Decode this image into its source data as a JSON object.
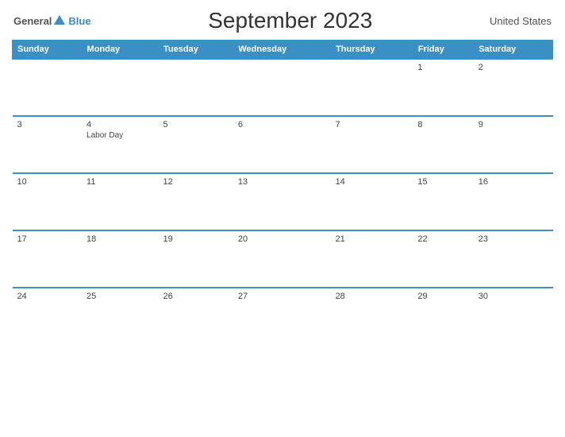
{
  "header": {
    "logo_general": "General",
    "logo_blue": "Blue",
    "title": "September 2023",
    "country": "United States"
  },
  "weekdays": [
    "Sunday",
    "Monday",
    "Tuesday",
    "Wednesday",
    "Thursday",
    "Friday",
    "Saturday"
  ],
  "weeks": [
    [
      {
        "day": "",
        "empty": true
      },
      {
        "day": "",
        "empty": true
      },
      {
        "day": "",
        "empty": true
      },
      {
        "day": "",
        "empty": true
      },
      {
        "day": "",
        "empty": true
      },
      {
        "day": "1",
        "empty": false
      },
      {
        "day": "2",
        "empty": false
      }
    ],
    [
      {
        "day": "3",
        "empty": false
      },
      {
        "day": "4",
        "empty": false,
        "holiday": "Labor Day"
      },
      {
        "day": "5",
        "empty": false
      },
      {
        "day": "6",
        "empty": false
      },
      {
        "day": "7",
        "empty": false
      },
      {
        "day": "8",
        "empty": false
      },
      {
        "day": "9",
        "empty": false
      }
    ],
    [
      {
        "day": "10",
        "empty": false
      },
      {
        "day": "11",
        "empty": false
      },
      {
        "day": "12",
        "empty": false
      },
      {
        "day": "13",
        "empty": false
      },
      {
        "day": "14",
        "empty": false
      },
      {
        "day": "15",
        "empty": false
      },
      {
        "day": "16",
        "empty": false
      }
    ],
    [
      {
        "day": "17",
        "empty": false
      },
      {
        "day": "18",
        "empty": false
      },
      {
        "day": "19",
        "empty": false
      },
      {
        "day": "20",
        "empty": false
      },
      {
        "day": "21",
        "empty": false
      },
      {
        "day": "22",
        "empty": false
      },
      {
        "day": "23",
        "empty": false
      }
    ],
    [
      {
        "day": "24",
        "empty": false
      },
      {
        "day": "25",
        "empty": false
      },
      {
        "day": "26",
        "empty": false
      },
      {
        "day": "27",
        "empty": false
      },
      {
        "day": "28",
        "empty": false
      },
      {
        "day": "29",
        "empty": false
      },
      {
        "day": "30",
        "empty": false
      }
    ]
  ]
}
